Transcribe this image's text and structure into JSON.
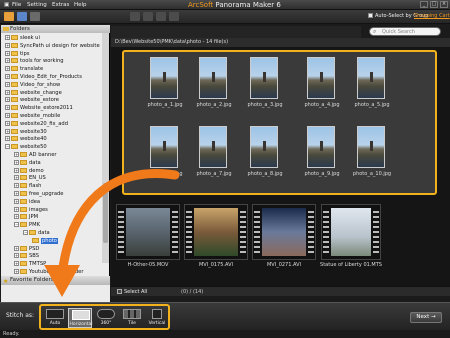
{
  "menu": {
    "file": "File",
    "setting": "Setting",
    "extras": "Extras",
    "help": "Help"
  },
  "app": {
    "brand": "ArcSoft",
    "title": "Panorama Maker 6"
  },
  "window_buttons": {
    "minimize": "_",
    "maximize": "□",
    "close": "×"
  },
  "toolbar": {
    "auto_select": "Auto-Select by Group",
    "shopping_cart": "Shopping Cart"
  },
  "search": {
    "placeholder": "Quick Search"
  },
  "folders": {
    "header": "Folders",
    "items": [
      {
        "label": "sleek ui",
        "indent": 0
      },
      {
        "label": "SyncPath ui design for website",
        "indent": 0
      },
      {
        "label": "tips",
        "indent": 0
      },
      {
        "label": "tools for working",
        "indent": 0
      },
      {
        "label": "translate",
        "indent": 0
      },
      {
        "label": "Video_Edit_for_Products",
        "indent": 0
      },
      {
        "label": "Video_for_show",
        "indent": 0
      },
      {
        "label": "website_change",
        "indent": 0
      },
      {
        "label": "website_estore",
        "indent": 0
      },
      {
        "label": "Website_estore2011",
        "indent": 0
      },
      {
        "label": "website_mobile",
        "indent": 0
      },
      {
        "label": "website20_fix_add",
        "indent": 0
      },
      {
        "label": "website30",
        "indent": 0
      },
      {
        "label": "website40",
        "indent": 0
      },
      {
        "label": "website50",
        "indent": 0
      },
      {
        "label": "AD banner",
        "indent": 1
      },
      {
        "label": "data",
        "indent": 1
      },
      {
        "label": "demo",
        "indent": 1
      },
      {
        "label": "EN_US",
        "indent": 1
      },
      {
        "label": "flash",
        "indent": 1
      },
      {
        "label": "free_upgrade",
        "indent": 1
      },
      {
        "label": "idea",
        "indent": 1
      },
      {
        "label": "images",
        "indent": 1
      },
      {
        "label": "JPM",
        "indent": 1
      },
      {
        "label": "PMK",
        "indent": 1
      },
      {
        "label": "data",
        "indent": 2
      },
      {
        "label": "photo",
        "indent": 3,
        "selected": true
      },
      {
        "label": "PSD",
        "indent": 1
      },
      {
        "label": "SBS",
        "indent": 1
      },
      {
        "label": "TMTSP",
        "indent": 1
      },
      {
        "label": "Youtube_Downloader",
        "indent": 1
      }
    ]
  },
  "favorites": {
    "header": "Favorite Folders"
  },
  "path": {
    "text": "D:\\Bev\\Website50\\PMK\\data\\photo - 14 file(s)"
  },
  "photos": [
    "photo_a_1.jpg",
    "photo_a_2.jpg",
    "photo_a_3.jpg",
    "photo_a_4.jpg",
    "photo_a_5.jpg",
    "photo_a_6.jpg",
    "photo_a_7.jpg",
    "photo_a_8.jpg",
    "photo_a_9.jpg",
    "photo_a_10.jpg"
  ],
  "videos": [
    "H-Other-05.MOV",
    "MVI_0175.AVI",
    "MVI_0271.AVI",
    "Statue of Liberty 01.MTS"
  ],
  "status": {
    "select_all": "Select All",
    "count": "(0) / (14)"
  },
  "stitch": {
    "label": "Stitch as:",
    "modes": [
      "Auto",
      "Horizontal",
      "360°",
      "Tile",
      "Vertical"
    ],
    "selected": "Horizontal"
  },
  "next": {
    "label": "Next"
  },
  "statusline": {
    "text": "Ready."
  },
  "colors": {
    "accent": "#f2b21b",
    "brand": "#f39a1e",
    "selection": "#2f6fcf"
  }
}
